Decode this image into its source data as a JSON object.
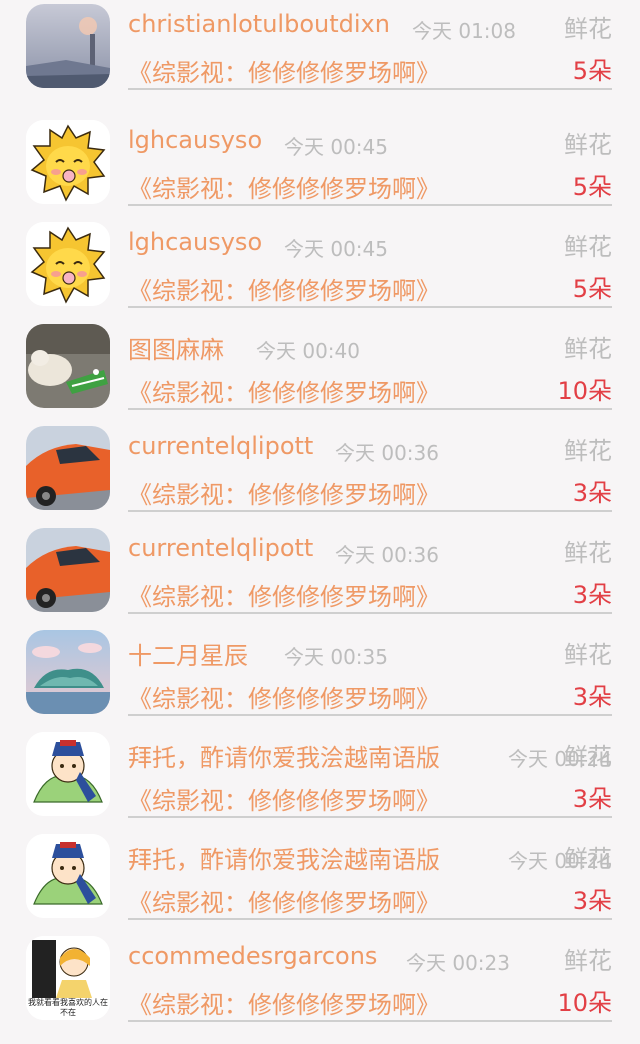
{
  "rows": [
    {
      "name": "christianlotulboutdixn",
      "time": "今天 01:08",
      "gift": "鲜花",
      "work": "《综影视：修修修修罗场啊》",
      "count": "5朵",
      "avatar": "foggy-landscape"
    },
    {
      "name": "lghcausyso",
      "time": "今天 00:45",
      "gift": "鲜花",
      "work": "《综影视：修修修修罗场啊》",
      "count": "5朵",
      "avatar": "yellow-lion-cartoon"
    },
    {
      "name": "lghcausyso",
      "time": "今天 00:45",
      "gift": "鲜花",
      "work": "《综影视：修修修修罗场啊》",
      "count": "5朵",
      "avatar": "yellow-lion-cartoon"
    },
    {
      "name": "图图麻麻",
      "time": "今天 00:40",
      "gift": "鲜花",
      "work": "《综影视：修修修修罗场啊》",
      "count": "10朵",
      "avatar": "dog-with-crocodile-toy"
    },
    {
      "name": "currentelqlipott",
      "time": "今天 00:36",
      "gift": "鲜花",
      "work": "《综影视：修修修修罗场啊》",
      "count": "3朵",
      "avatar": "orange-car"
    },
    {
      "name": "currentelqlipott",
      "time": "今天 00:36",
      "gift": "鲜花",
      "work": "《综影视：修修修修罗场啊》",
      "count": "3朵",
      "avatar": "orange-car"
    },
    {
      "name": "十二月星辰",
      "time": "今天 00:35",
      "gift": "鲜花",
      "work": "《综影视：修修修修罗场啊》",
      "count": "3朵",
      "avatar": "fantasy-island"
    },
    {
      "name": "拜托，酢请你爱我浍越南语版",
      "time": "今天 00:24",
      "gift": "鲜花",
      "work": "《综影视：修修修修罗场啊》",
      "count": "3朵",
      "avatar": "cartoon-dumpling-boy"
    },
    {
      "name": "拜托，酢请你爱我浍越南语版",
      "time": "今天 00:24",
      "gift": "鲜花",
      "work": "《综影视：修修修修罗场啊》",
      "count": "3朵",
      "avatar": "cartoon-dumpling-boy"
    },
    {
      "name": "ccommedesrgarcons",
      "time": "今天 00:23",
      "gift": "鲜花",
      "work": "《综影视：修修修修罗场啊》",
      "count": "10朵",
      "avatar": "meme-girl",
      "avatar_caption": "我就看看我喜欢的人在不在"
    }
  ],
  "colors": {
    "name": "#ef9965",
    "time": "#bdbdbd",
    "gift": "#bdbdbd",
    "count": "#e23f45",
    "background": "#f7f5f6"
  }
}
